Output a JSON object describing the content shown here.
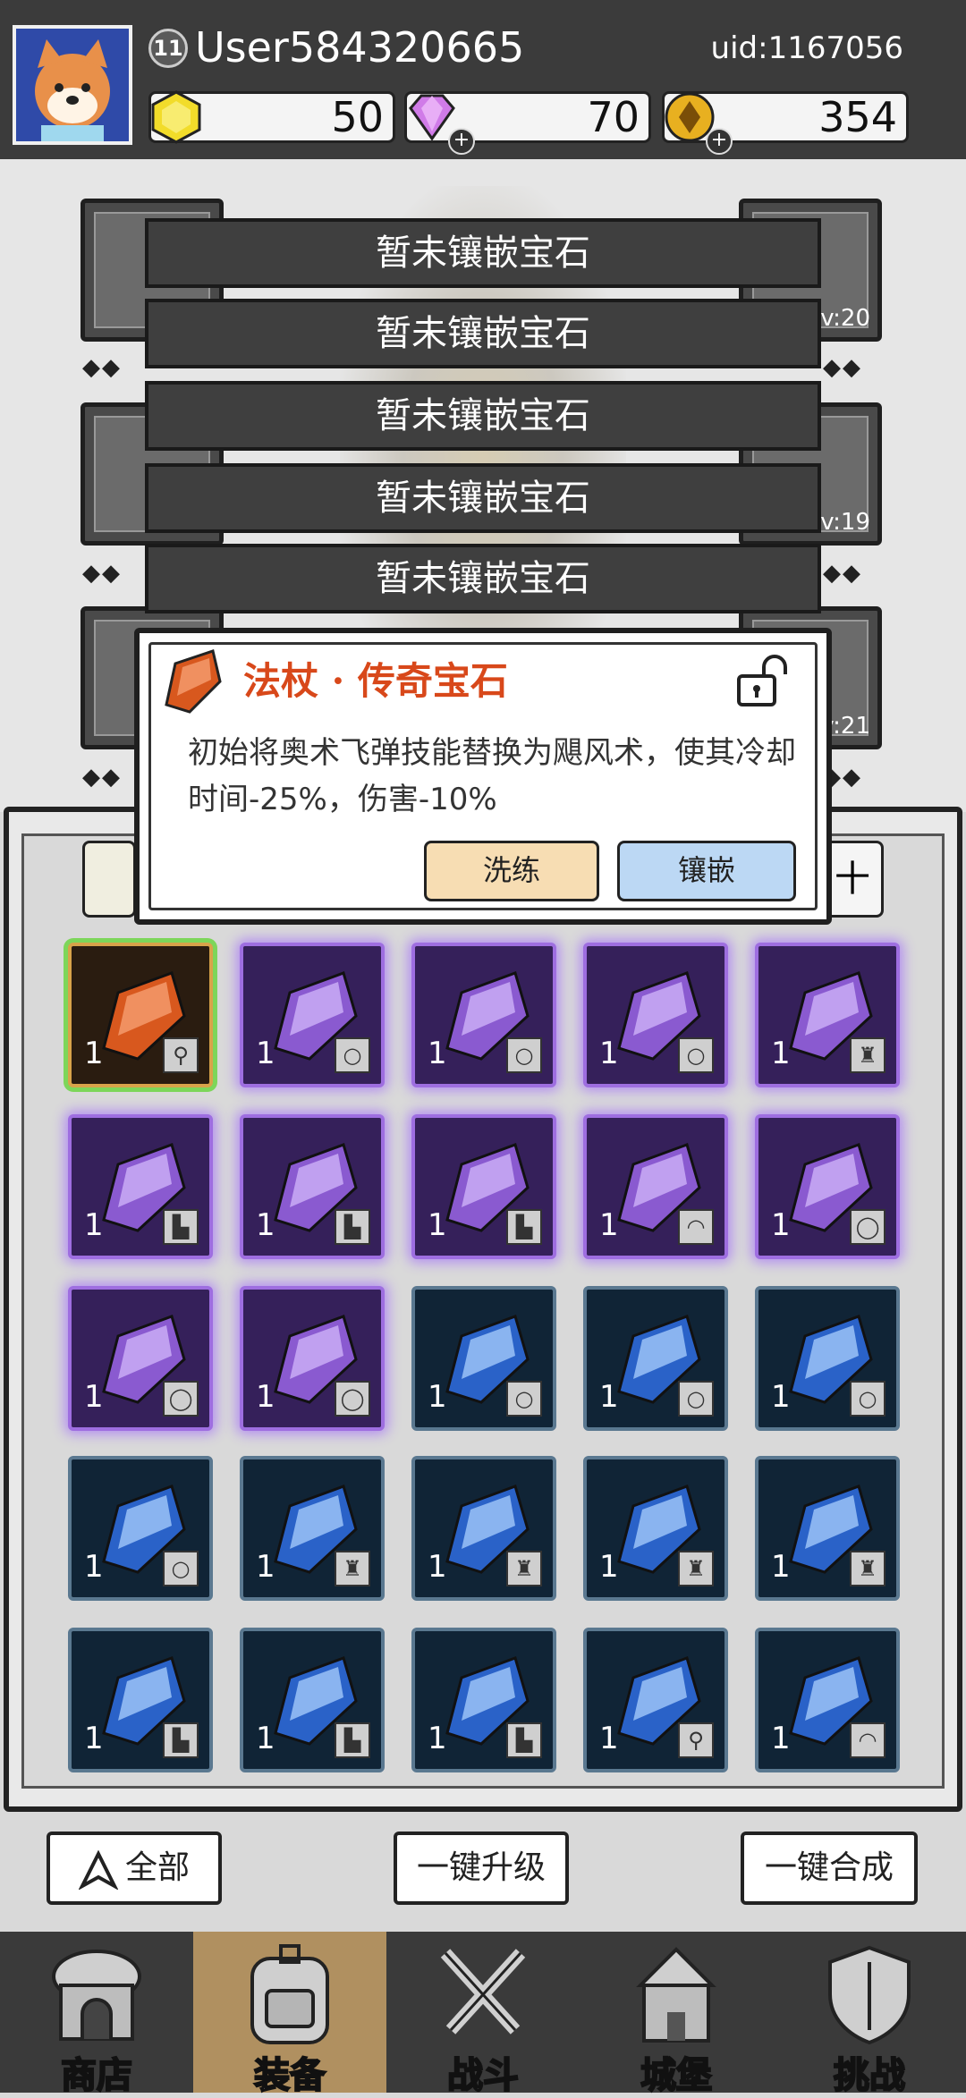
{
  "header": {
    "level": "11",
    "username": "User584320665",
    "uid": "uid:1167056",
    "currencies": [
      {
        "name": "gold-gem",
        "value": "50",
        "has_plus": false,
        "color": "#f2dc2a"
      },
      {
        "name": "diamond",
        "value": "70",
        "has_plus": true,
        "color": "#d07be8"
      },
      {
        "name": "coin",
        "value": "354",
        "has_plus": true,
        "color": "#e8b020"
      }
    ]
  },
  "equipment": {
    "slots": [
      {
        "side": "left",
        "level": ""
      },
      {
        "side": "right",
        "level": "Lv:20"
      },
      {
        "side": "left",
        "level": ""
      },
      {
        "side": "right",
        "level": "Lv:19"
      },
      {
        "side": "left",
        "level": ""
      },
      {
        "side": "right",
        "level": "Lv:21"
      }
    ],
    "diamond_row": "◆◆"
  },
  "gem_sockets": [
    {
      "label": "暂未镶嵌宝石"
    },
    {
      "label": "暂未镶嵌宝石"
    },
    {
      "label": "暂未镶嵌宝石"
    },
    {
      "label": "暂未镶嵌宝石"
    },
    {
      "label": "暂未镶嵌宝石"
    }
  ],
  "popup": {
    "title": "法杖 · 传奇宝石",
    "description": "初始将奥术飞弹技能替换为飓风术，使其冷却时间-25%，伤害-10%",
    "refine_label": "洗练",
    "inlay_label": "镶嵌",
    "title_color": "#d8481a"
  },
  "inventory": {
    "right_tab_icon": "十",
    "items": [
      {
        "rarity": "orange",
        "count": "1",
        "type_icon": "staff"
      },
      {
        "rarity": "purple",
        "count": "1",
        "type_icon": "ring"
      },
      {
        "rarity": "purple",
        "count": "1",
        "type_icon": "ring"
      },
      {
        "rarity": "purple",
        "count": "1",
        "type_icon": "ring"
      },
      {
        "rarity": "purple",
        "count": "1",
        "type_icon": "armor"
      },
      {
        "rarity": "purple",
        "count": "1",
        "type_icon": "boots"
      },
      {
        "rarity": "purple",
        "count": "1",
        "type_icon": "boots"
      },
      {
        "rarity": "purple",
        "count": "1",
        "type_icon": "boots"
      },
      {
        "rarity": "purple",
        "count": "1",
        "type_icon": "helmet"
      },
      {
        "rarity": "purple",
        "count": "1",
        "type_icon": "necklace"
      },
      {
        "rarity": "purple",
        "count": "1",
        "type_icon": "necklace"
      },
      {
        "rarity": "purple",
        "count": "1",
        "type_icon": "necklace"
      },
      {
        "rarity": "blue",
        "count": "1",
        "type_icon": "ring"
      },
      {
        "rarity": "blue",
        "count": "1",
        "type_icon": "ring"
      },
      {
        "rarity": "blue",
        "count": "1",
        "type_icon": "ring"
      },
      {
        "rarity": "blue",
        "count": "1",
        "type_icon": "ring"
      },
      {
        "rarity": "blue",
        "count": "1",
        "type_icon": "armor"
      },
      {
        "rarity": "blue",
        "count": "1",
        "type_icon": "armor"
      },
      {
        "rarity": "blue",
        "count": "1",
        "type_icon": "armor"
      },
      {
        "rarity": "blue",
        "count": "1",
        "type_icon": "armor"
      },
      {
        "rarity": "blue",
        "count": "1",
        "type_icon": "boots"
      },
      {
        "rarity": "blue",
        "count": "1",
        "type_icon": "boots"
      },
      {
        "rarity": "blue",
        "count": "1",
        "type_icon": "boots"
      },
      {
        "rarity": "blue",
        "count": "1",
        "type_icon": "staff"
      },
      {
        "rarity": "blue",
        "count": "1",
        "type_icon": "helmet"
      }
    ]
  },
  "actions": {
    "filter_label": "全部",
    "upgrade_all_label": "一键升级",
    "merge_all_label": "一键合成"
  },
  "nav": [
    {
      "name": "shop",
      "label": "商店",
      "active": false
    },
    {
      "name": "equipment",
      "label": "装备",
      "active": true
    },
    {
      "name": "battle",
      "label": "战斗",
      "active": false
    },
    {
      "name": "castle",
      "label": "城堡",
      "active": false
    },
    {
      "name": "challenge",
      "label": "挑战",
      "active": false
    }
  ]
}
